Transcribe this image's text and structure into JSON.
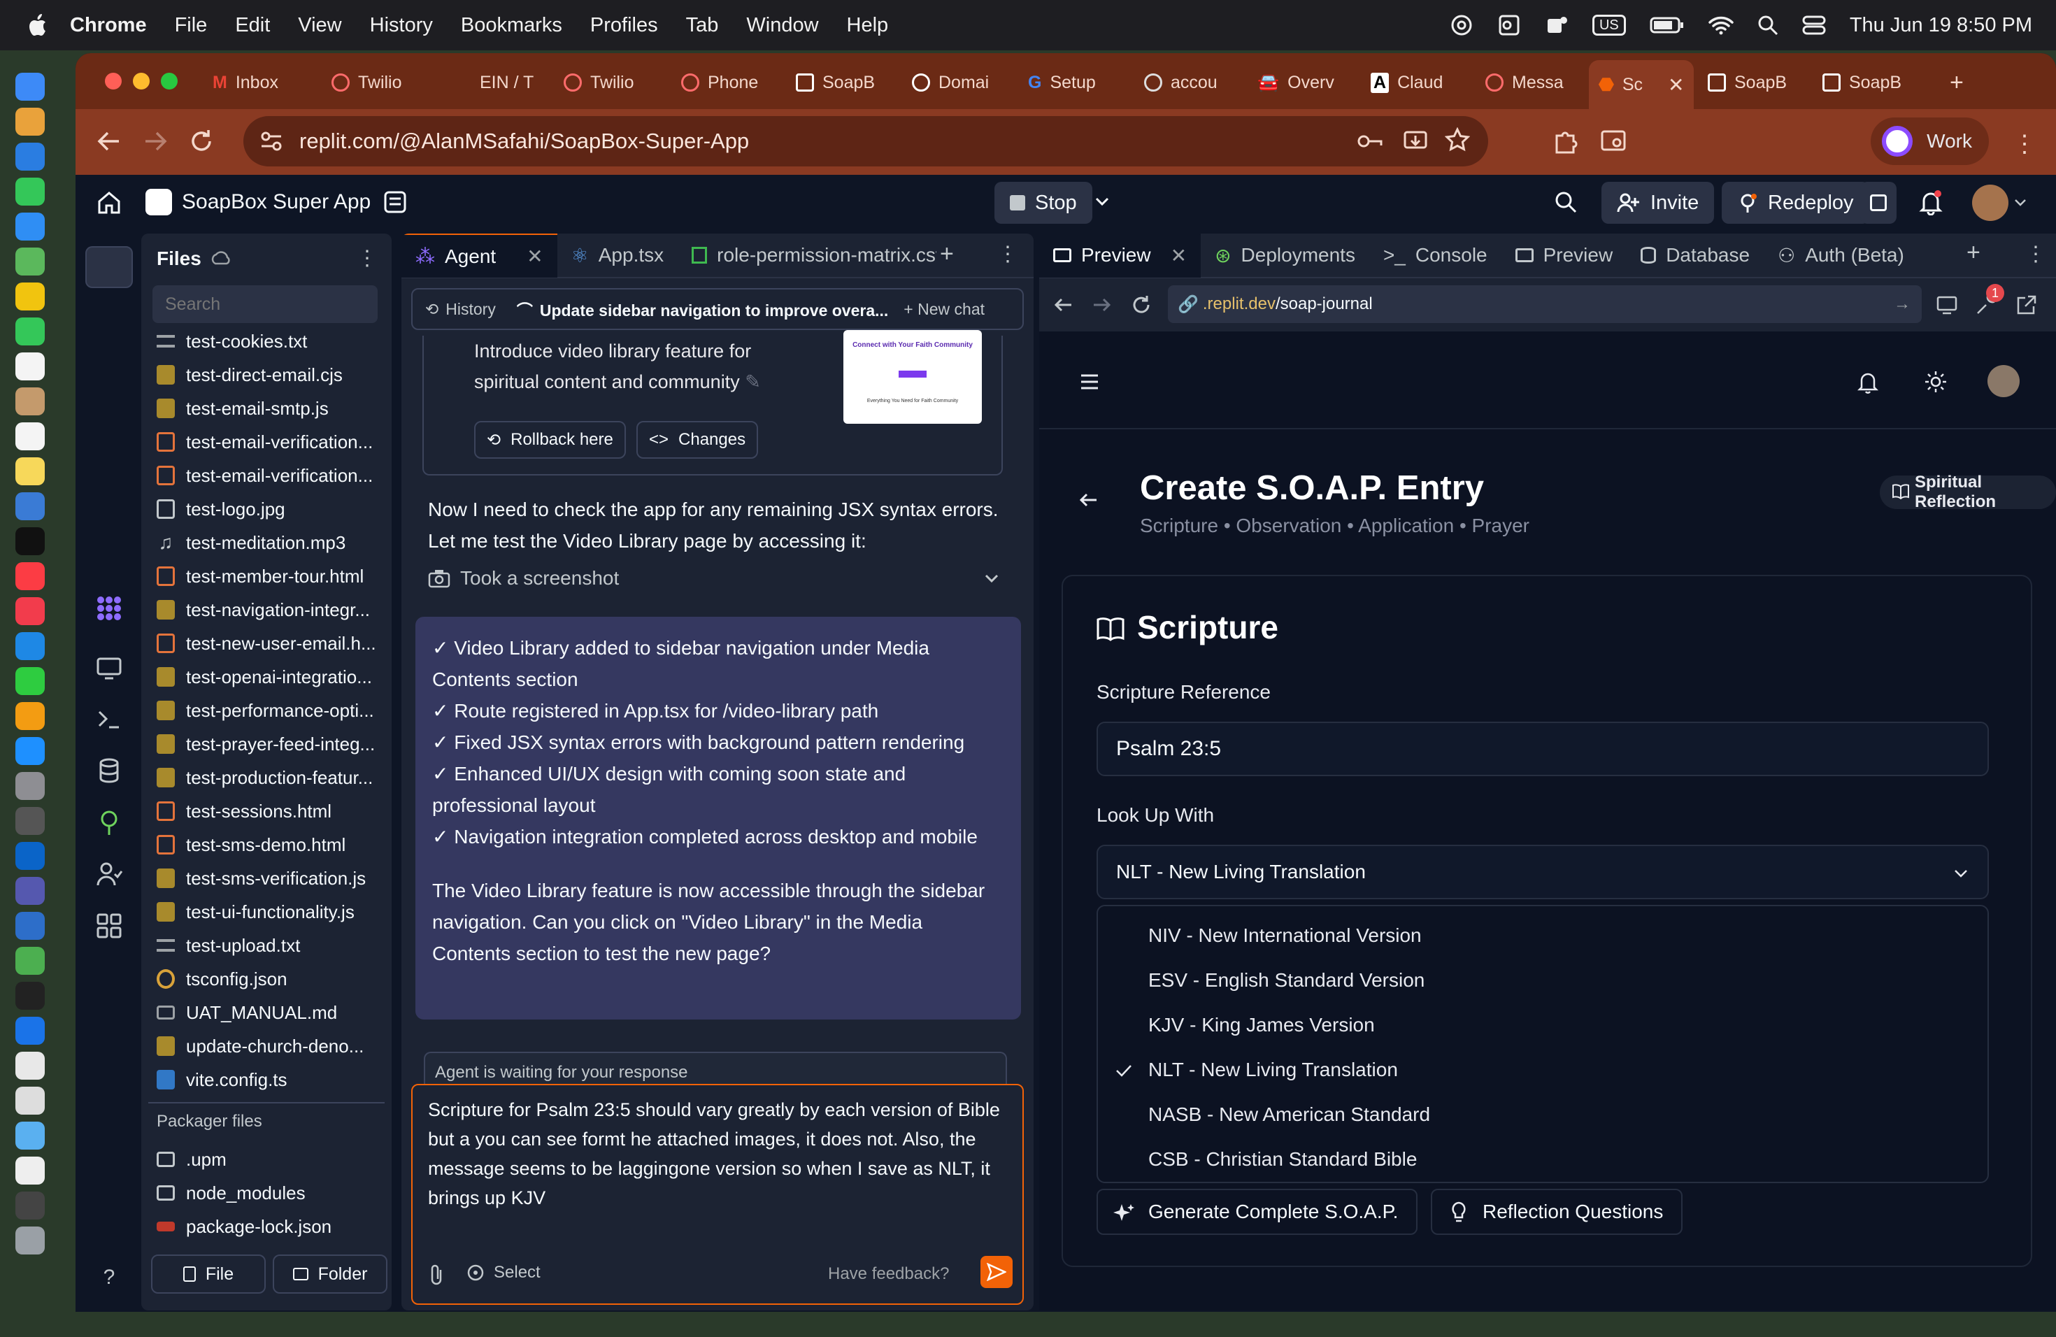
{
  "menubar": {
    "app": "Chrome",
    "items": [
      "File",
      "Edit",
      "View",
      "History",
      "Bookmarks",
      "Profiles",
      "Tab",
      "Window",
      "Help"
    ],
    "lang": "US",
    "datetime": "Thu Jun 19  8:50 PM"
  },
  "tabs": [
    "Inbox",
    "Twilio",
    "EIN / T",
    "Twilio",
    "Phone",
    "SoapB",
    "Domai",
    "Setup",
    "accou",
    "Overv",
    "Claud",
    "Messa",
    "Sc",
    "SoapB",
    "SoapB"
  ],
  "toolbar": {
    "url": "replit.com/@AlanMSafahi/SoapBox-Super-App",
    "profile": "Work"
  },
  "replit": {
    "project": "SoapBox Super App",
    "stop": "Stop",
    "invite": "Invite",
    "redeploy": "Redeploy",
    "files_title": "Files",
    "search_placeholder": "Search",
    "files": [
      "test-cookies.txt",
      "test-direct-email.cjs",
      "test-email-smtp.js",
      "test-email-verification...",
      "test-email-verification...",
      "test-logo.jpg",
      "test-meditation.mp3",
      "test-member-tour.html",
      "test-navigation-integr...",
      "test-new-user-email.h...",
      "test-openai-integratio...",
      "test-performance-opti...",
      "test-prayer-feed-integ...",
      "test-production-featur...",
      "test-sessions.html",
      "test-sms-demo.html",
      "test-sms-verification.js",
      "test-ui-functionality.js",
      "test-upload.txt",
      "tsconfig.json",
      "UAT_MANUAL.md",
      "update-church-deno...",
      "vite.config.ts"
    ],
    "packager_title": "Packager files",
    "packager": [
      ".upm",
      "node_modules",
      "package-lock.json"
    ],
    "file_btn": "File",
    "folder_btn": "Folder"
  },
  "agent": {
    "tabs": [
      "Agent",
      "App.tsx",
      "role-permission-matrix.csv"
    ],
    "history": "History",
    "thread": "Update sidebar navigation to improve overa...",
    "new_chat": "New chat",
    "checkpoint_line1": "Introduce video library feature for",
    "checkpoint_line2": "spiritual content and community",
    "thumb_title": "Connect with Your Faith Community",
    "thumb_footer": "Everything You Need for Faith Community",
    "rollback": "Rollback here",
    "changes": "Changes",
    "msg1": "Now I need to check the app for any remaining JSX syntax errors. Let me test the Video Library page by accessing it:",
    "screenshot": "Took a screenshot",
    "checks": [
      "✓ Video Library added to sidebar navigation under Media Contents section",
      "✓ Route registered in App.tsx for /video-library path",
      "✓ Fixed JSX syntax errors with background pattern rendering",
      "✓ Enhanced UI/UX design with coming soon state and professional layout",
      "✓ Navigation integration completed across desktop and mobile"
    ],
    "msg2": "The Video Library feature is now accessible through the sidebar navigation. Can you click on \"Video Library\" in the Media Contents section to test the new page?",
    "waiting": "Agent is waiting for your response",
    "input": "Scripture for Psalm 23:5 should vary greatly by each version of Bible but a you can see formt he attached images, it does not. Also, the message seems to be laggingone version so when I save  as NLT, it brings up KJV",
    "select": "Select",
    "feedback": "Have feedback?"
  },
  "preview": {
    "tabs": [
      "Preview",
      "Deployments",
      "Console",
      "Preview",
      "Database",
      "Auth (Beta)"
    ],
    "url_pre": ".replit.dev",
    "url_path": "/soap-journal",
    "notif_count": "1",
    "title": "Create S.O.A.P. Entry",
    "subtitle": "Scripture • Observation • Application • Prayer",
    "badge": "Spiritual Reflection",
    "section": "Scripture",
    "ref_label": "Scripture Reference",
    "ref_value": "Psalm 23:5",
    "lookup_label": "Look Up With",
    "selected": "NLT - New Living Translation",
    "options": [
      "NIV - New International Version",
      "ESV - English Standard Version",
      "KJV - King James Version",
      "NLT - New Living Translation",
      "NASB - New American Standard",
      "CSB - Christian Standard Bible"
    ],
    "gen_btn": "Generate Complete S.O.A.P.",
    "reflect_btn": "Reflection Questions"
  },
  "colors": {
    "accent": "#f26207",
    "tabbar": "#6b2a15",
    "panel": "#1c2333",
    "bg": "#0e1525",
    "chat": "#353860"
  }
}
